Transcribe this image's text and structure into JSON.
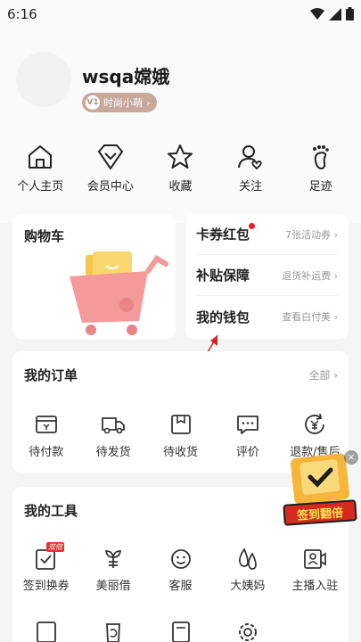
{
  "status_bar": {
    "time": "6:16"
  },
  "profile": {
    "username": "wsqa嫦娥",
    "member_level": "时尚小萌",
    "member_logo": "V1"
  },
  "quick_nav": [
    {
      "label": "个人主页",
      "icon": "home-icon"
    },
    {
      "label": "会员中心",
      "icon": "vip-icon"
    },
    {
      "label": "收藏",
      "icon": "star-icon"
    },
    {
      "label": "关注",
      "icon": "follow-icon"
    },
    {
      "label": "足迹",
      "icon": "footprint-icon"
    }
  ],
  "cart": {
    "title": "购物车"
  },
  "wallet_links": [
    {
      "label": "卡券红包",
      "sub": "7张活动券",
      "has_dot": true
    },
    {
      "label": "补贴保障",
      "sub": "退货补运费",
      "has_dot": false
    },
    {
      "label": "我的钱包",
      "sub": "查看白付美",
      "has_dot": false
    }
  ],
  "orders": {
    "title": "我的订单",
    "all_label": "全部",
    "items": [
      {
        "label": "待付款",
        "icon": "wallet-icon"
      },
      {
        "label": "待发货",
        "icon": "truck-icon"
      },
      {
        "label": "待收货",
        "icon": "package-icon"
      },
      {
        "label": "评价",
        "icon": "comment-icon"
      },
      {
        "label": "退款/售后",
        "icon": "refund-icon"
      }
    ]
  },
  "tools": {
    "title": "我的工具",
    "items": [
      {
        "label": "签到换券",
        "icon": "checkin-icon",
        "tag": "双倍"
      },
      {
        "label": "美丽借",
        "icon": "loan-icon"
      },
      {
        "label": "客服",
        "icon": "service-icon"
      },
      {
        "label": "大姨妈",
        "icon": "period-icon"
      },
      {
        "label": "主播入驻",
        "icon": "streamer-icon"
      }
    ]
  },
  "promo": {
    "label": "签到翻倍",
    "close": "×"
  },
  "colors": {
    "accent_red": "#e91d2c",
    "badge_bg": "#c9a89d",
    "cart_pink": "#f49a9b",
    "cart_yellow": "#f7c64f"
  }
}
